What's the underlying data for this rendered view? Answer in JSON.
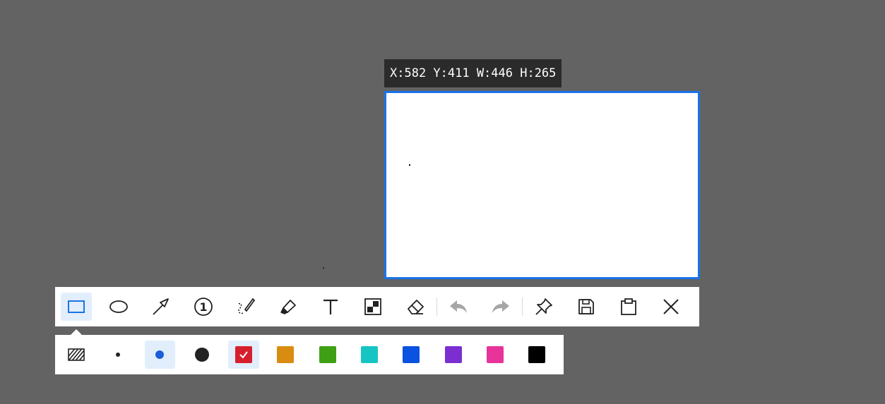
{
  "info_bar": {
    "text": "X:582 Y:411 W:446 H:265"
  },
  "toolbar": {
    "tools": [
      {
        "name": "rectangle",
        "active": true
      },
      {
        "name": "ellipse",
        "active": false
      },
      {
        "name": "arrow",
        "active": false
      },
      {
        "name": "number-marker",
        "active": false
      },
      {
        "name": "pen",
        "active": false
      },
      {
        "name": "highlighter",
        "active": false
      },
      {
        "name": "text",
        "active": false
      },
      {
        "name": "mosaic",
        "active": false
      },
      {
        "name": "eraser",
        "active": false
      },
      {
        "name": "undo",
        "enabled": false
      },
      {
        "name": "redo",
        "enabled": false
      },
      {
        "name": "pin",
        "active": false
      },
      {
        "name": "save",
        "active": false
      },
      {
        "name": "copy-to-clipboard",
        "active": false
      },
      {
        "name": "close",
        "active": false
      }
    ],
    "number_marker_label": "1"
  },
  "palette": {
    "fill_toggle": "hatch",
    "sizes": [
      "small",
      "medium",
      "large"
    ],
    "selected_size": "medium",
    "colors": [
      "#d61f2c",
      "#d98c12",
      "#3fa015",
      "#16c4c4",
      "#0c52e0",
      "#7b2fd1",
      "#e8339a",
      "#000000"
    ],
    "selected_color": "#d61f2c"
  }
}
